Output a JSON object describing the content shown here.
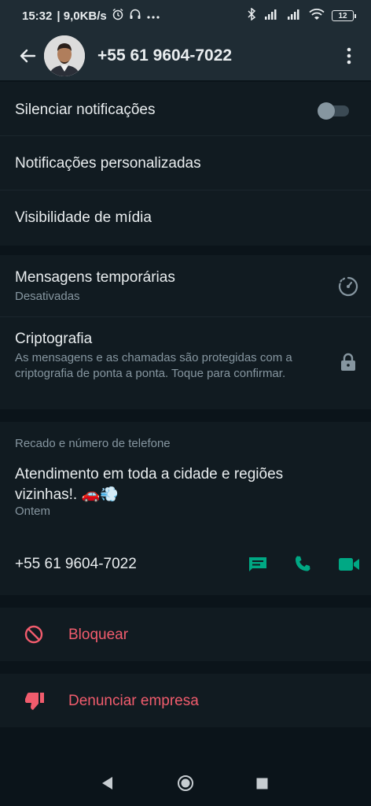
{
  "status_bar": {
    "time": "15:32",
    "speed": "| 9,0KB/s",
    "battery": "12"
  },
  "header": {
    "contact_name": "+55 61 9604-7022"
  },
  "settings": {
    "mute_label": "Silenciar notificações",
    "custom_notifications_label": "Notificações personalizadas",
    "media_visibility_label": "Visibilidade de mídia"
  },
  "privacy": {
    "disappearing_title": "Mensagens temporárias",
    "disappearing_status": "Desativadas",
    "encryption_title": "Criptografia",
    "encryption_desc": "As mensagens e as chamadas são protegidas com a criptografia de ponta a ponta. Toque para confirmar."
  },
  "about": {
    "section_title": "Recado e número de telefone",
    "status_text": "Atendimento em toda a cidade e regiões vizinhas!. 🚗💨",
    "status_date": "Ontem",
    "phone_number": "+55 61 9604-7022"
  },
  "actions": {
    "block_label": "Bloquear",
    "report_label": "Denunciar empresa"
  },
  "colors": {
    "accent": "#00a884",
    "danger": "#f15c6d",
    "background": "#0b141a",
    "panel": "#111b21"
  }
}
